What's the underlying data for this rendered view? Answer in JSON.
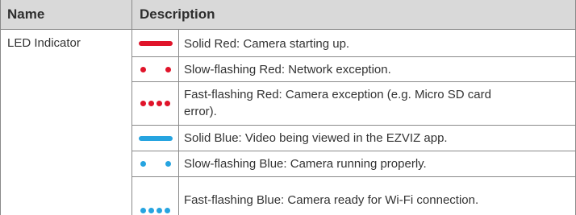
{
  "header": {
    "name": "Name",
    "description": "Description"
  },
  "row_name": "LED Indicator",
  "colors": {
    "red": "#e0142a",
    "blue": "#26a4e0"
  },
  "rows": [
    {
      "icon": "solid-red-led-icon",
      "text": "Solid Red: Camera starting up."
    },
    {
      "icon": "slow-flashing-red-led-icon",
      "text": "Slow-flashing Red: Network exception."
    },
    {
      "icon": "fast-flashing-red-led-icon",
      "text": "Fast-flashing Red: Camera exception (e.g. Micro SD card error)."
    },
    {
      "icon": "solid-blue-led-icon",
      "text": "Solid Blue: Video being viewed in the EZVIZ app."
    },
    {
      "icon": "slow-flashing-blue-led-icon",
      "text": "Slow-flashing Blue: Camera running properly."
    },
    {
      "icon": "fast-flashing-blue-led-icon",
      "text": "Fast-flashing Blue: Camera ready for Wi-Fi connection."
    }
  ]
}
